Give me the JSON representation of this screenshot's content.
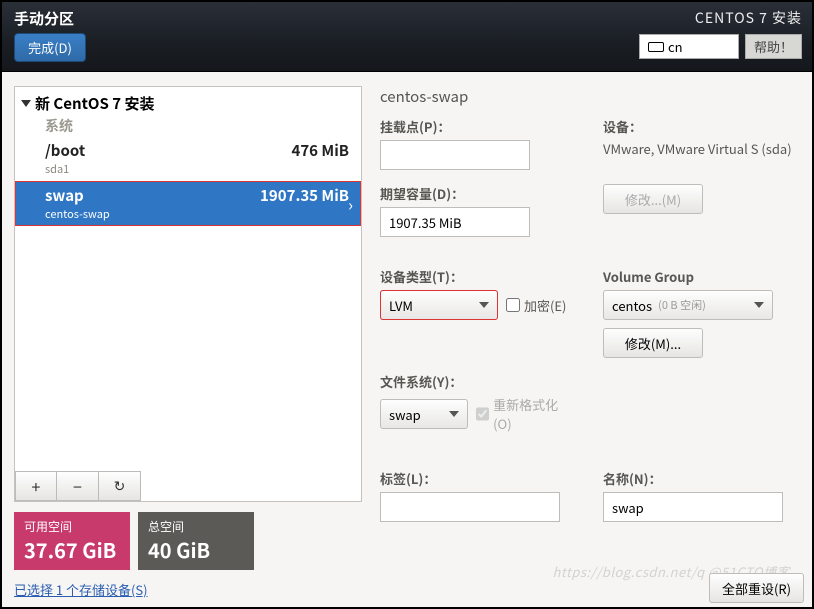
{
  "top": {
    "title": "手动分区",
    "done": "完成(D)",
    "right_title": "CENTOS 7 安装",
    "kb": "cn",
    "help": "帮助！"
  },
  "tree": {
    "install_title": "新 CentOS 7 安装",
    "system": "系统",
    "items": [
      {
        "name": "/boot",
        "sub": "sda1",
        "size": "476 MiB",
        "selected": false
      },
      {
        "name": "swap",
        "sub": "centos-swap",
        "size": "1907.35 MiB",
        "selected": true
      }
    ]
  },
  "summary": {
    "avail_label": "可用空间",
    "avail_value": "37.67 GiB",
    "total_label": "总空间",
    "total_value": "40 GiB"
  },
  "storage_link": "已选择 1 个存储设备(S)",
  "panel": {
    "title": "centos-swap",
    "mount_label": "挂载点(P)：",
    "mount_value": "",
    "capacity_label": "期望容量(D)：",
    "capacity_value": "1907.35 MiB",
    "device_label": "设备：",
    "device_value": "VMware, VMware Virtual S (sda)",
    "modify1": "修改...(M)",
    "type_label": "设备类型(T)：",
    "type_value": "LVM",
    "encrypt": "加密(E)",
    "vg_label": "Volume Group",
    "vg_value": "centos",
    "vg_free": "(0 B 空闲)",
    "modify2": "修改(M)...",
    "fs_label": "文件系统(Y)：",
    "fs_value": "swap",
    "reformat": "重新格式化(O)",
    "tag_label": "标签(L)：",
    "tag_value": "",
    "name_label": "名称(N)：",
    "name_value": "swap",
    "resetall": "全部重设(R)"
  },
  "watermark": "https://blog.csdn.net/q @51CTO博客"
}
